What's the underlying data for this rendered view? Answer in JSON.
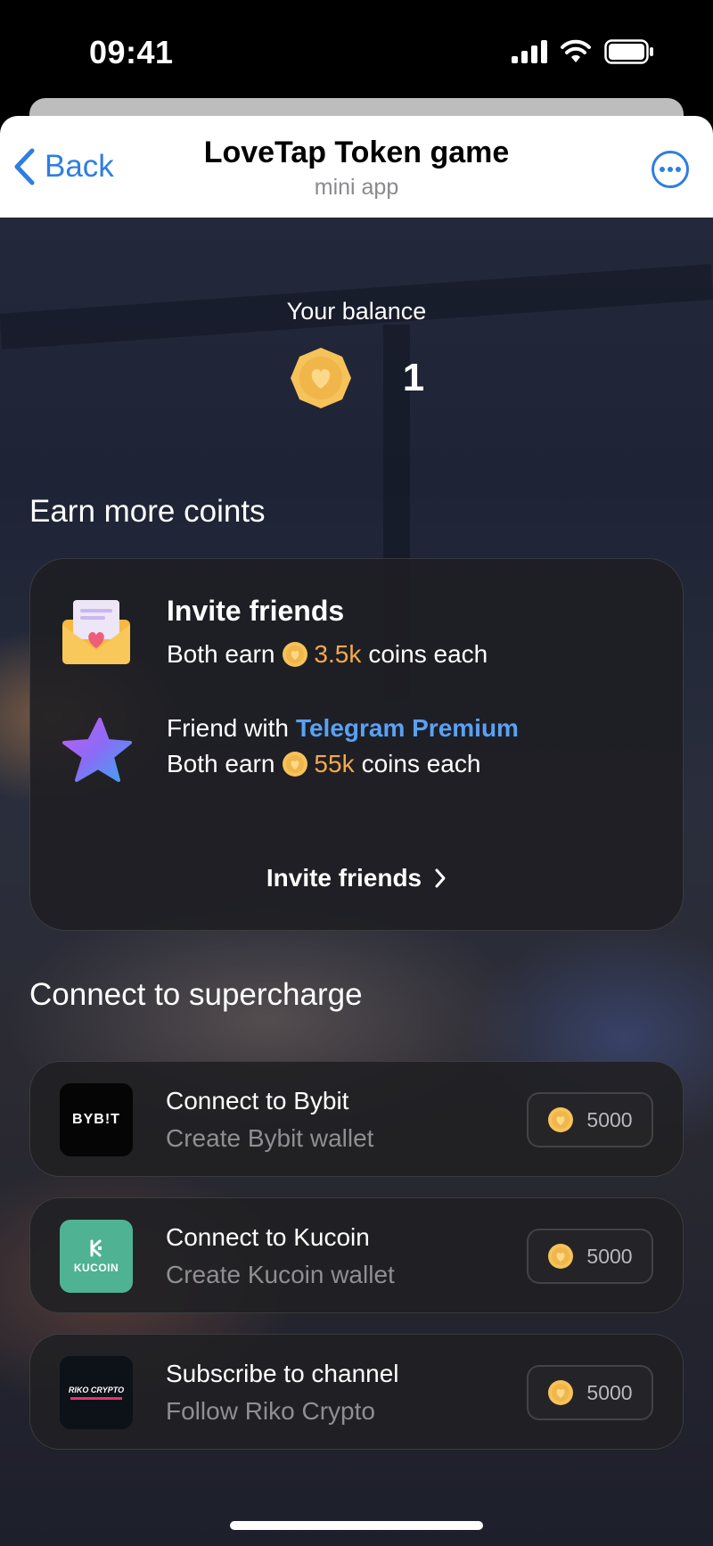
{
  "status_bar": {
    "time": "09:41"
  },
  "header": {
    "back_label": "Back",
    "title": "LoveTap Token game",
    "subtitle": "mini app"
  },
  "balance": {
    "label": "Your balance",
    "value": "1"
  },
  "earn": {
    "title": "Earn more coints",
    "invite": {
      "title": "Invite friends",
      "prefix": "Both earn",
      "amount": "3.5k",
      "suffix": "coins each"
    },
    "premium": {
      "prefix": "Friend with",
      "highlight": "Telegram Premium",
      "line2_prefix": "Both earn",
      "amount": "55k",
      "suffix": "coins each"
    },
    "cta": "Invite friends"
  },
  "connect": {
    "title": "Connect to supercharge",
    "tasks": [
      {
        "title": "Connect to Bybit",
        "subtitle": "Create Bybit wallet",
        "reward": "5000",
        "logo_text": "BYB!T"
      },
      {
        "title": "Connect to Kucoin",
        "subtitle": "Create Kucoin wallet",
        "reward": "5000",
        "logo_text": "KUCOIN"
      },
      {
        "title": "Subscribe to channel",
        "subtitle": "Follow Riko Crypto",
        "reward": "5000",
        "logo_text": "RIKO CRYPTO"
      }
    ]
  },
  "colors": {
    "accent_blue": "#2f7ee0",
    "coin_gold": "#f6c25a",
    "amount_orange": "#f6a94c",
    "premium_blue": "#5aa1f5",
    "kucoin_green": "#4fb393"
  },
  "icons": [
    "chevron-left-icon",
    "more-icon",
    "coin-icon",
    "envelope-heart-icon",
    "premium-star-icon",
    "chevron-right-icon"
  ]
}
